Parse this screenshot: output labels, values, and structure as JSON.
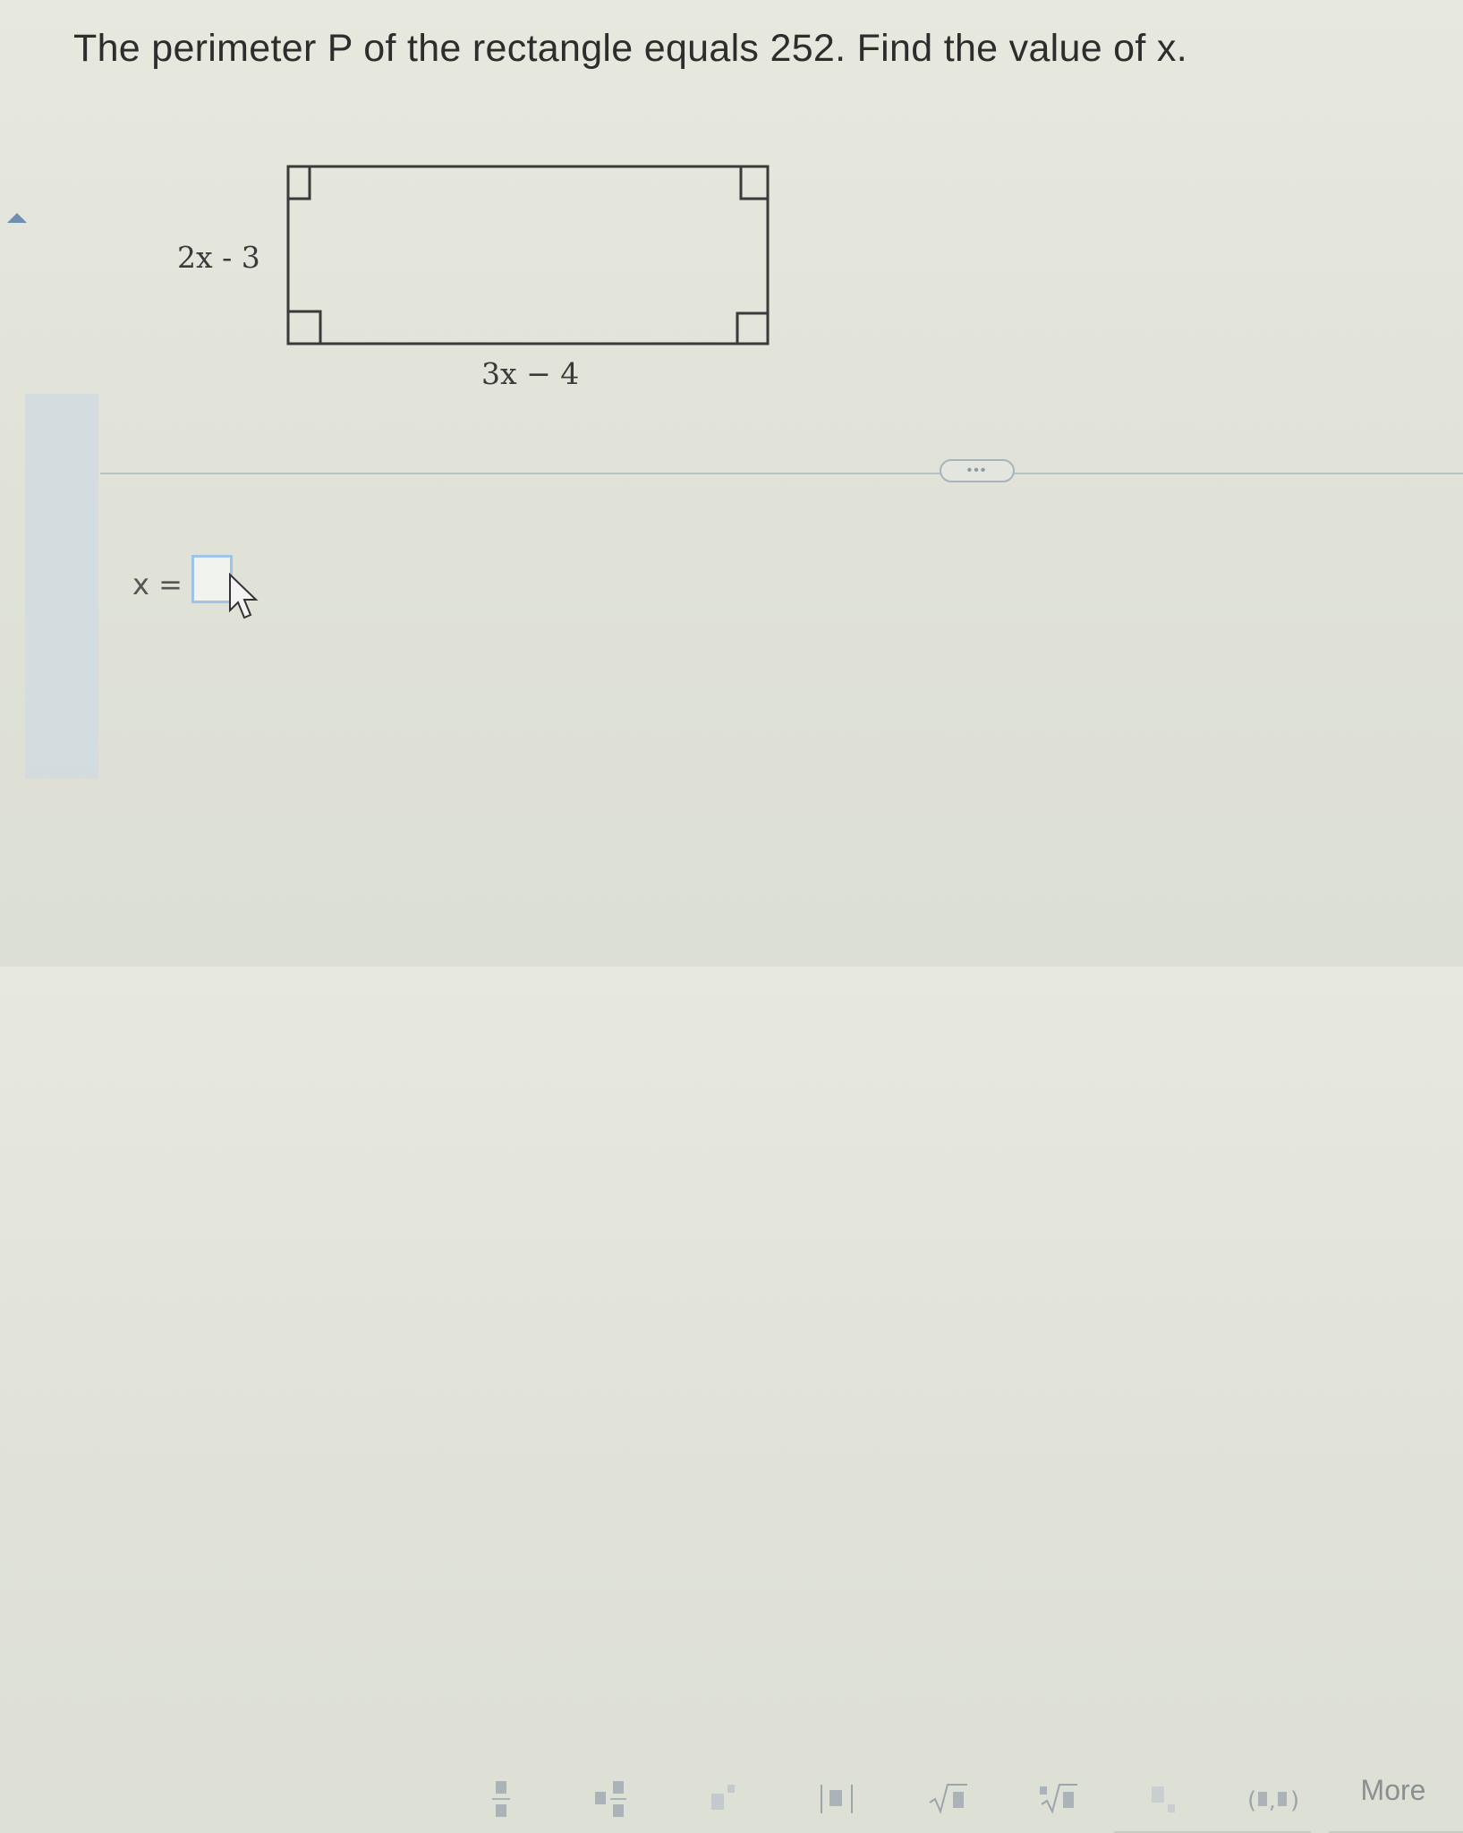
{
  "question": {
    "text": "The perimeter P of the rectangle equals 252. Find the value of x."
  },
  "figure": {
    "side_label_height": "2x - 3",
    "side_label_width": "3x − 4"
  },
  "answer": {
    "label": "x =",
    "value": ""
  },
  "divider": {
    "ellipsis": "•••"
  },
  "toolbar": {
    "tools": [
      "fraction",
      "mixed-number",
      "exponent",
      "absolute-value",
      "square-root",
      "nth-root",
      "subscript",
      "ordered-pair"
    ],
    "more_label": "More"
  },
  "colors": {
    "background": "#e4e5dc",
    "input_border": "#9ec4ea",
    "accent": "#6e8fb0"
  }
}
